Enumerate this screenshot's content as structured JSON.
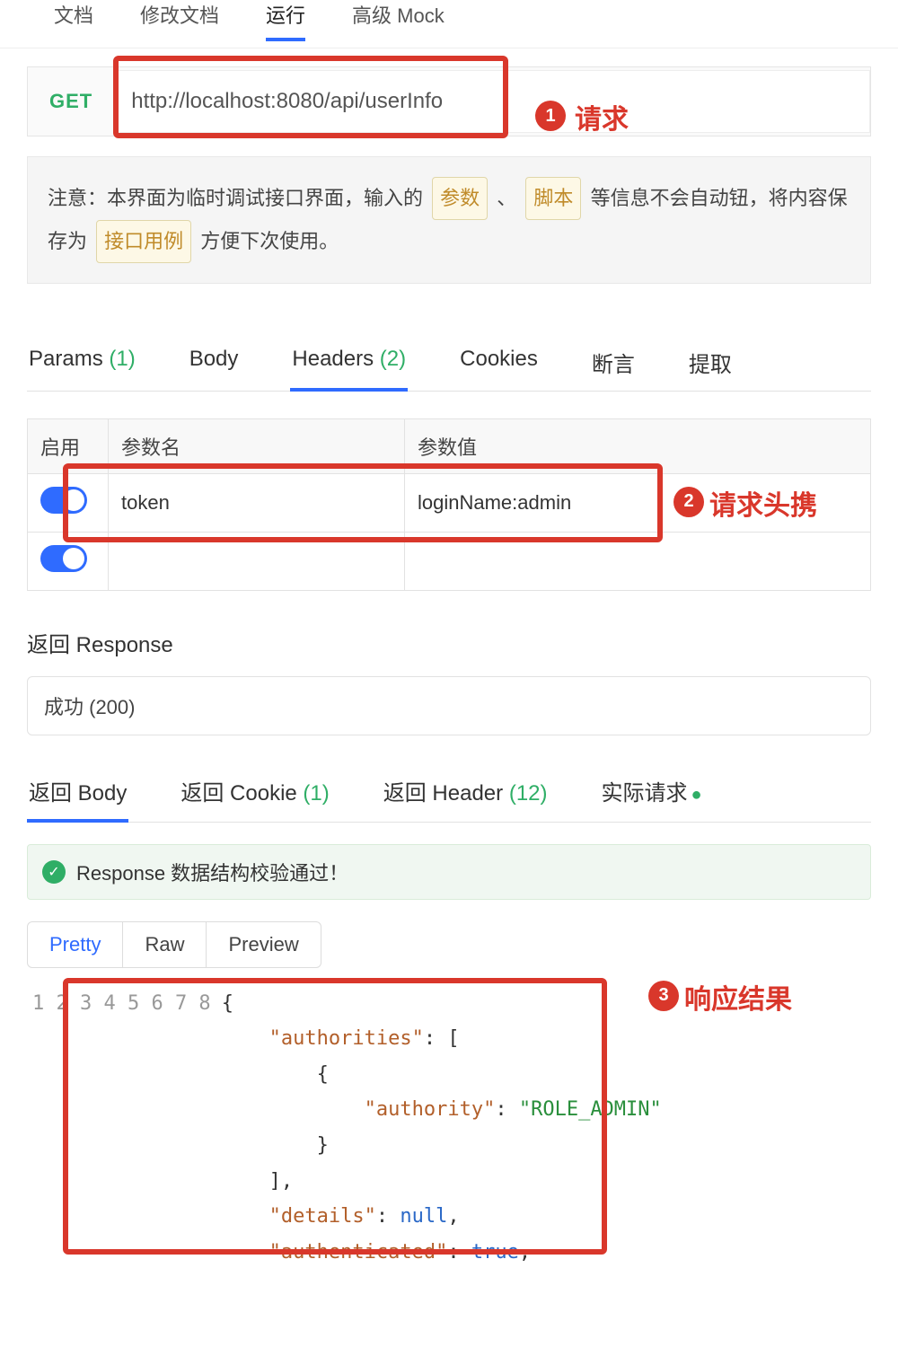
{
  "topTabs": {
    "items": [
      "文档",
      "修改文档",
      "运行",
      "高级 Mock"
    ],
    "activeIndex": 2
  },
  "request": {
    "method": "GET",
    "url": "http://localhost:8080/api/userInfo"
  },
  "annotations": {
    "a1": {
      "num": "1",
      "label": "请求"
    },
    "a2": {
      "num": "2",
      "label": "请求头携"
    },
    "a3": {
      "num": "3",
      "label": "响应结果"
    }
  },
  "note": {
    "prefix": "注意：本界面为临时调试接口界面，输入的",
    "chip1": "参数",
    "sep1": "、",
    "chip2": "脚本",
    "mid": "等信息不会自动钮，将内容保存为",
    "chip3": "接口用例",
    "suffix": "方便下次使用。"
  },
  "subTabs": {
    "items": [
      {
        "label": "Params",
        "count": "(1)"
      },
      {
        "label": "Body",
        "count": ""
      },
      {
        "label": "Headers",
        "count": "(2)"
      },
      {
        "label": "Cookies",
        "count": ""
      },
      {
        "label": "断言",
        "count": ""
      },
      {
        "label": "提取",
        "count": ""
      }
    ],
    "activeIndex": 2
  },
  "headersTable": {
    "cols": {
      "c1": "启用",
      "c2": "参数名",
      "c3": "参数值"
    },
    "rows": [
      {
        "enabled": true,
        "name": "token",
        "value": "loginName:admin"
      },
      {
        "enabled": true,
        "name": "",
        "value": ""
      }
    ]
  },
  "response": {
    "label": "返回 Response",
    "statusOption": "成功 (200)"
  },
  "respTabs": {
    "items": [
      {
        "label": "返回 Body",
        "count": ""
      },
      {
        "label": "返回 Cookie",
        "count": "(1)"
      },
      {
        "label": "返回 Header",
        "count": "(12)"
      },
      {
        "label": "实际请求",
        "count": "",
        "dot": true
      }
    ],
    "activeIndex": 0
  },
  "validation": {
    "text": "Response 数据结构校验通过！"
  },
  "viewModes": {
    "items": [
      "Pretty",
      "Raw",
      "Preview"
    ],
    "activeIndex": 0
  },
  "responseBody": {
    "lineNumbers": [
      "1",
      "2",
      "3",
      "4",
      "5",
      "6",
      "7",
      "8"
    ],
    "tokens": [
      [
        {
          "t": "p",
          "v": "{"
        }
      ],
      [
        {
          "t": "p",
          "v": "    "
        },
        {
          "t": "k",
          "v": "\"authorities\""
        },
        {
          "t": "p",
          "v": ": ["
        }
      ],
      [
        {
          "t": "p",
          "v": "        {"
        }
      ],
      [
        {
          "t": "p",
          "v": "            "
        },
        {
          "t": "k",
          "v": "\"authority\""
        },
        {
          "t": "p",
          "v": ": "
        },
        {
          "t": "s",
          "v": "\"ROLE_ADMIN\""
        }
      ],
      [
        {
          "t": "p",
          "v": "        }"
        }
      ],
      [
        {
          "t": "p",
          "v": "    ],"
        }
      ],
      [
        {
          "t": "p",
          "v": "    "
        },
        {
          "t": "k",
          "v": "\"details\""
        },
        {
          "t": "p",
          "v": ": "
        },
        {
          "t": "n",
          "v": "null"
        },
        {
          "t": "p",
          "v": ","
        }
      ],
      [
        {
          "t": "p",
          "v": "    "
        },
        {
          "t": "k",
          "v": "\"authenticated\""
        },
        {
          "t": "p",
          "v": ": "
        },
        {
          "t": "n",
          "v": "true"
        },
        {
          "t": "p",
          "v": ","
        }
      ]
    ]
  }
}
